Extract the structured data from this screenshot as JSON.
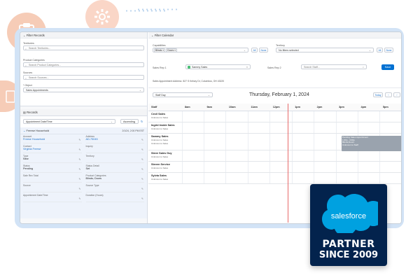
{
  "left": {
    "filter_records_title": "Filter Records",
    "territories": {
      "label": "Territories",
      "placeholder": "Search Territories..."
    },
    "product_categories": {
      "label": "Product Categories",
      "placeholder": "Search Product Categories..."
    },
    "sources": {
      "label": "Sources",
      "placeholder": "Search Sources..."
    },
    "object": {
      "label": "* Object",
      "value": "Sales Appointments"
    },
    "records_title": "Records",
    "sort": {
      "field": "Appointment Date/Time",
      "order": "Ascending"
    },
    "record": {
      "title": "Freese Household",
      "date": "2/1/24, 2:00 PM EST",
      "fields": [
        {
          "k": "Account",
          "v": "Freese Household",
          "link": true
        },
        {
          "k": "Address",
          "v": "AD-75045",
          "link": true
        },
        {
          "k": "Contact",
          "v": "Virginia Freese",
          "link": true
        },
        {
          "k": "Inquiry",
          "v": "",
          "link": false
        },
        {
          "k": "Type",
          "v": "New",
          "link": false
        },
        {
          "k": "Territory",
          "v": "",
          "link": false
        },
        {
          "k": "Status",
          "v": "Pending",
          "link": false
        },
        {
          "k": "Status Detail",
          "v": "Set",
          "link": false
        },
        {
          "k": "Sale Rev Total",
          "v": "",
          "link": false
        },
        {
          "k": "Product Categories",
          "v": "Blinds; Doors",
          "link": false
        },
        {
          "k": "Source",
          "v": "",
          "link": false
        },
        {
          "k": "Source Type",
          "v": "",
          "link": false
        },
        {
          "k": "Appointment Date/Time",
          "v": "",
          "link": false
        },
        {
          "k": "Duration (Hours)",
          "v": "",
          "link": false
        }
      ]
    }
  },
  "right": {
    "filter_calendar_title": "Filter Calendar",
    "capabilities": {
      "label": "Capabilities",
      "tags": [
        "Blinds",
        "Doors"
      ]
    },
    "territory": {
      "label": "Territory",
      "value": "No filters selected"
    },
    "all_label": "All",
    "none_label": "None",
    "sales_rep_1": {
      "label": "Sales Rep 1",
      "value": "Sammy Sales"
    },
    "sales_rep_2": {
      "label": "Sales Rep 2",
      "placeholder": "Search Staff..."
    },
    "save_label": "Save",
    "address": {
      "label": "Sales Appointment Address",
      "value": "827 S Kelsey Dr, Columbus, OH 43220"
    },
    "view": "Staff Day",
    "date_title": "Thursday, February 1, 2024",
    "today_label": "Today",
    "prev": "‹",
    "next": "›",
    "columns": [
      "Staff",
      "8am",
      "9am",
      "10am",
      "11am",
      "12pm",
      "1pm",
      "2pm",
      "3pm",
      "4pm",
      "5pm"
    ],
    "staff": [
      {
        "name": "Cecil Sales",
        "sub": [
          "Unknown to Sales"
        ]
      },
      {
        "name": "Ingrid Inside Sales",
        "sub": [
          "Unknown to Sales"
        ]
      },
      {
        "name": "Sammy Sales",
        "sub": [
          "Unknown to Sales",
          "Unknown to Sales"
        ]
      },
      {
        "name": "Steve Sales Guy",
        "sub": [
          "Unknown to Sales"
        ]
      },
      {
        "name": "Steven Service",
        "sub": [
          "Unknown to Sales"
        ]
      },
      {
        "name": "Sylvia Sales",
        "sub": [
          "Unknown to Sales"
        ]
      }
    ],
    "appointment": {
      "lines": [
        "Pending Sales Appointment",
        "1:00p - 3:00p",
        "Blinds;Doors",
        "Unknown to Staff"
      ],
      "row": 2
    }
  },
  "badge": {
    "logo_text": "salesforce",
    "line1": "PARTNER",
    "line2": "SINCE 2009"
  },
  "colors": {
    "accent": "#0070d2",
    "badge_bg": "#03234d",
    "cloud": "#00a1e0",
    "frame": "#d2e3f6",
    "decor": "#f6ccb7"
  }
}
